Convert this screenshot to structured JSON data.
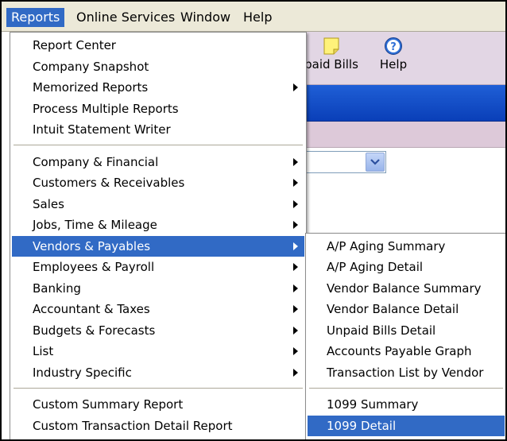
{
  "menubar": {
    "items": [
      {
        "label": "Reports",
        "active": true
      },
      {
        "label": "Online Services",
        "active": false
      },
      {
        "label": "Window",
        "active": false
      },
      {
        "label": "Help",
        "active": false
      }
    ]
  },
  "toolbar": {
    "unpaid_bills_label": "paid Bills",
    "help_label": "Help"
  },
  "reports_menu": {
    "group1": [
      "Report Center",
      "Company Snapshot",
      "Memorized Reports",
      "Process Multiple Reports",
      "Intuit Statement Writer"
    ],
    "group2": [
      "Company & Financial",
      "Customers & Receivables",
      "Sales",
      "Jobs, Time & Mileage",
      "Vendors & Payables",
      "Employees & Payroll",
      "Banking",
      "Accountant & Taxes",
      "Budgets & Forecasts",
      "List",
      "Industry Specific"
    ],
    "group3": [
      "Custom Summary Report",
      "Custom Transaction Detail Report"
    ],
    "highlighted": "Vendors & Payables"
  },
  "vendors_submenu": {
    "group1": [
      "A/P Aging Summary",
      "A/P Aging Detail",
      "Vendor Balance Summary",
      "Vendor Balance Detail",
      "Unpaid Bills Detail",
      "Accounts Payable Graph",
      "Transaction List by Vendor"
    ],
    "group2": [
      "1099 Summary",
      "1099 Detail"
    ],
    "highlighted": "1099 Detail"
  },
  "colors": {
    "highlight": "#316ac5",
    "menubar": "#ece9d8",
    "titlebar": "#0a3fb8"
  }
}
